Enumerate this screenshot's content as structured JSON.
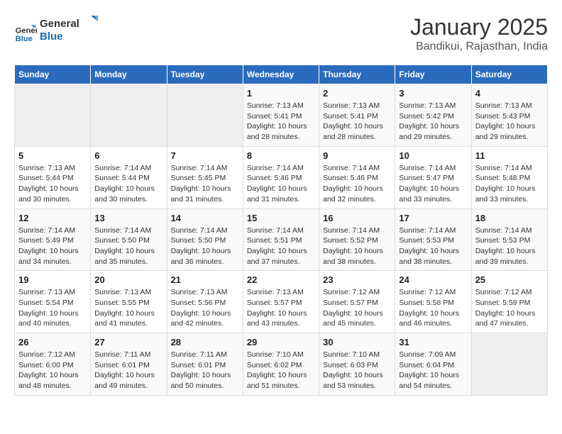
{
  "logo": {
    "line1": "General",
    "line2": "Blue"
  },
  "title": "January 2025",
  "subtitle": "Bandikui, Rajasthan, India",
  "weekdays": [
    "Sunday",
    "Monday",
    "Tuesday",
    "Wednesday",
    "Thursday",
    "Friday",
    "Saturday"
  ],
  "weeks": [
    [
      {
        "day": null
      },
      {
        "day": null
      },
      {
        "day": null
      },
      {
        "day": 1,
        "sunrise": "7:13 AM",
        "sunset": "5:41 PM",
        "daylight": "10 hours and 28 minutes."
      },
      {
        "day": 2,
        "sunrise": "7:13 AM",
        "sunset": "5:41 PM",
        "daylight": "10 hours and 28 minutes."
      },
      {
        "day": 3,
        "sunrise": "7:13 AM",
        "sunset": "5:42 PM",
        "daylight": "10 hours and 29 minutes."
      },
      {
        "day": 4,
        "sunrise": "7:13 AM",
        "sunset": "5:43 PM",
        "daylight": "10 hours and 29 minutes."
      }
    ],
    [
      {
        "day": 5,
        "sunrise": "7:13 AM",
        "sunset": "5:44 PM",
        "daylight": "10 hours and 30 minutes."
      },
      {
        "day": 6,
        "sunrise": "7:14 AM",
        "sunset": "5:44 PM",
        "daylight": "10 hours and 30 minutes."
      },
      {
        "day": 7,
        "sunrise": "7:14 AM",
        "sunset": "5:45 PM",
        "daylight": "10 hours and 31 minutes."
      },
      {
        "day": 8,
        "sunrise": "7:14 AM",
        "sunset": "5:46 PM",
        "daylight": "10 hours and 31 minutes."
      },
      {
        "day": 9,
        "sunrise": "7:14 AM",
        "sunset": "5:46 PM",
        "daylight": "10 hours and 32 minutes."
      },
      {
        "day": 10,
        "sunrise": "7:14 AM",
        "sunset": "5:47 PM",
        "daylight": "10 hours and 33 minutes."
      },
      {
        "day": 11,
        "sunrise": "7:14 AM",
        "sunset": "5:48 PM",
        "daylight": "10 hours and 33 minutes."
      }
    ],
    [
      {
        "day": 12,
        "sunrise": "7:14 AM",
        "sunset": "5:49 PM",
        "daylight": "10 hours and 34 minutes."
      },
      {
        "day": 13,
        "sunrise": "7:14 AM",
        "sunset": "5:50 PM",
        "daylight": "10 hours and 35 minutes."
      },
      {
        "day": 14,
        "sunrise": "7:14 AM",
        "sunset": "5:50 PM",
        "daylight": "10 hours and 36 minutes."
      },
      {
        "day": 15,
        "sunrise": "7:14 AM",
        "sunset": "5:51 PM",
        "daylight": "10 hours and 37 minutes."
      },
      {
        "day": 16,
        "sunrise": "7:14 AM",
        "sunset": "5:52 PM",
        "daylight": "10 hours and 38 minutes."
      },
      {
        "day": 17,
        "sunrise": "7:14 AM",
        "sunset": "5:53 PM",
        "daylight": "10 hours and 38 minutes."
      },
      {
        "day": 18,
        "sunrise": "7:14 AM",
        "sunset": "5:53 PM",
        "daylight": "10 hours and 39 minutes."
      }
    ],
    [
      {
        "day": 19,
        "sunrise": "7:13 AM",
        "sunset": "5:54 PM",
        "daylight": "10 hours and 40 minutes."
      },
      {
        "day": 20,
        "sunrise": "7:13 AM",
        "sunset": "5:55 PM",
        "daylight": "10 hours and 41 minutes."
      },
      {
        "day": 21,
        "sunrise": "7:13 AM",
        "sunset": "5:56 PM",
        "daylight": "10 hours and 42 minutes."
      },
      {
        "day": 22,
        "sunrise": "7:13 AM",
        "sunset": "5:57 PM",
        "daylight": "10 hours and 43 minutes."
      },
      {
        "day": 23,
        "sunrise": "7:12 AM",
        "sunset": "5:57 PM",
        "daylight": "10 hours and 45 minutes."
      },
      {
        "day": 24,
        "sunrise": "7:12 AM",
        "sunset": "5:58 PM",
        "daylight": "10 hours and 46 minutes."
      },
      {
        "day": 25,
        "sunrise": "7:12 AM",
        "sunset": "5:59 PM",
        "daylight": "10 hours and 47 minutes."
      }
    ],
    [
      {
        "day": 26,
        "sunrise": "7:12 AM",
        "sunset": "6:00 PM",
        "daylight": "10 hours and 48 minutes."
      },
      {
        "day": 27,
        "sunrise": "7:11 AM",
        "sunset": "6:01 PM",
        "daylight": "10 hours and 49 minutes."
      },
      {
        "day": 28,
        "sunrise": "7:11 AM",
        "sunset": "6:01 PM",
        "daylight": "10 hours and 50 minutes."
      },
      {
        "day": 29,
        "sunrise": "7:10 AM",
        "sunset": "6:02 PM",
        "daylight": "10 hours and 51 minutes."
      },
      {
        "day": 30,
        "sunrise": "7:10 AM",
        "sunset": "6:03 PM",
        "daylight": "10 hours and 53 minutes."
      },
      {
        "day": 31,
        "sunrise": "7:09 AM",
        "sunset": "6:04 PM",
        "daylight": "10 hours and 54 minutes."
      },
      {
        "day": null
      }
    ]
  ],
  "labels": {
    "sunrise": "Sunrise:",
    "sunset": "Sunset:",
    "daylight": "Daylight:"
  }
}
